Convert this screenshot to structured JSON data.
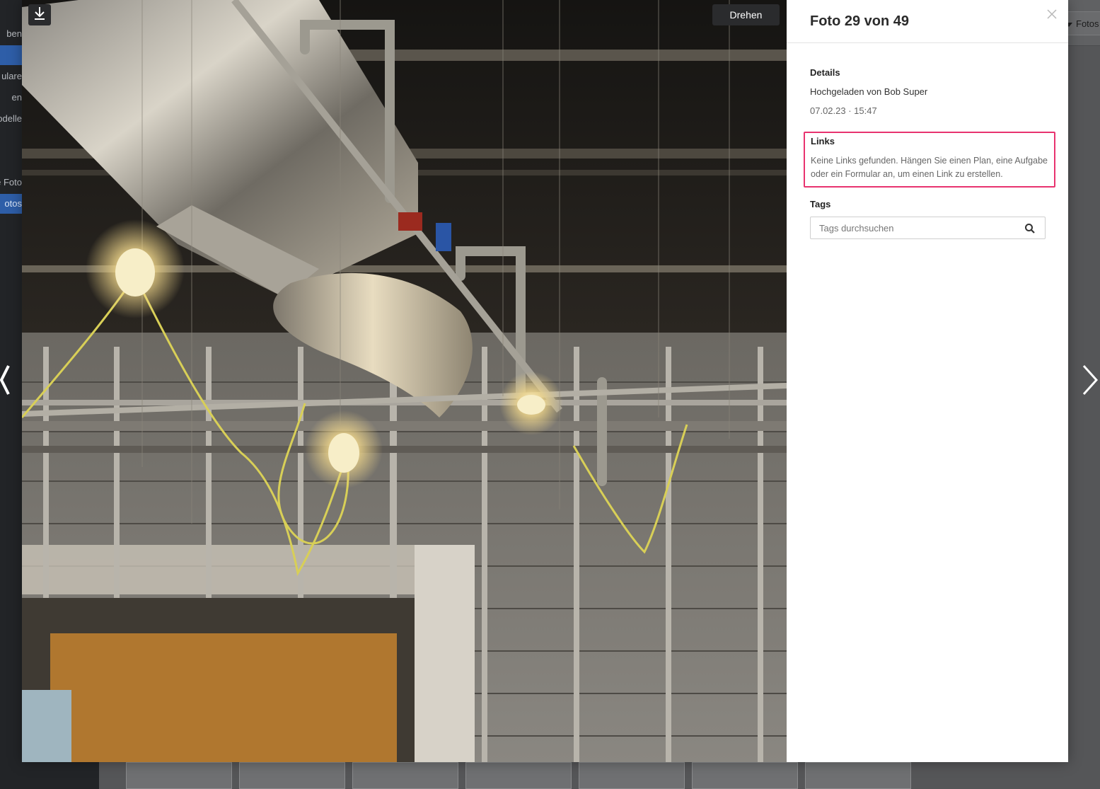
{
  "background": {
    "sidebar_items": [
      {
        "label": "ben",
        "active": false
      },
      {
        "label": "",
        "active": true
      },
      {
        "label": "ulare",
        "active": false
      },
      {
        "label": "en",
        "active": false
      },
      {
        "label": "odelle",
        "active": false
      },
      {
        "label": "e Foto",
        "active": false
      },
      {
        "label": "otos",
        "active": true
      }
    ],
    "filter_label": "Fotos"
  },
  "viewer": {
    "download_icon": "download-icon",
    "rotate_label": "Drehen",
    "prev_icon": "chevron-left-icon",
    "next_icon": "chevron-right-icon"
  },
  "info": {
    "title": "Foto 29 von 49",
    "close_icon": "close-icon",
    "details_heading": "Details",
    "uploaded_by": "Hochgeladen von Bob Super",
    "timestamp": "07.02.23 · 15:47",
    "links_heading": "Links",
    "links_empty": "Keine Links gefunden. Hängen Sie einen Plan, eine Aufgabe oder ein Formular an, um einen Link zu erstellen.",
    "tags_heading": "Tags",
    "tags_placeholder": "Tags durchsuchen",
    "tags_value": "",
    "search_icon": "search-icon"
  },
  "colors": {
    "highlight": "#e8336f",
    "sidebar_active": "#2e5ea8"
  }
}
